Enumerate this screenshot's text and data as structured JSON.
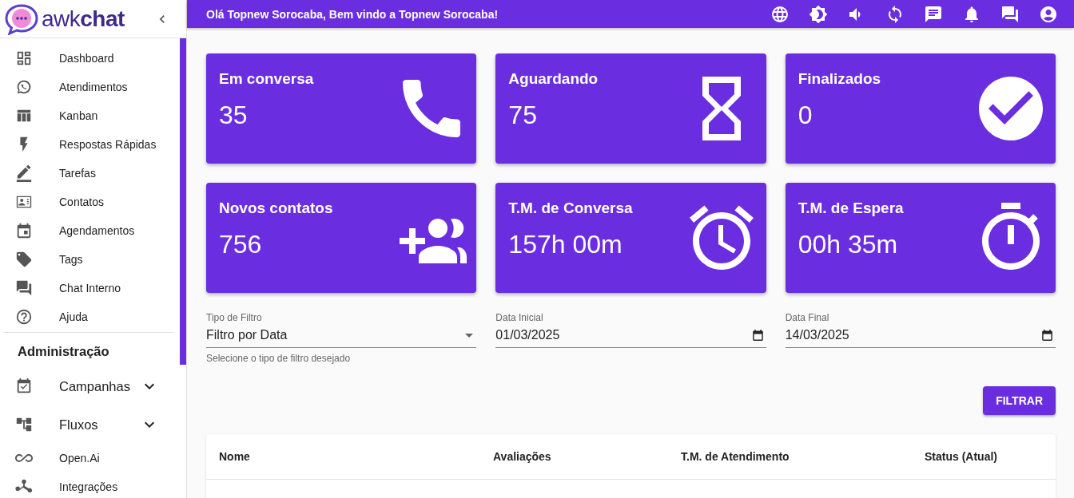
{
  "logo": {
    "text": "awk**chat**"
  },
  "topbar": {
    "greeting": "Olá Topnew Sorocaba, Bem vindo a Topnew Sorocaba!"
  },
  "sidebar": {
    "items": [
      {
        "label": "Dashboard",
        "kind": "link"
      },
      {
        "label": "Atendimentos",
        "kind": "link"
      },
      {
        "label": "Kanban",
        "kind": "link"
      },
      {
        "label": "Respostas Rápidas",
        "kind": "link"
      },
      {
        "label": "Tarefas",
        "kind": "link"
      },
      {
        "label": "Contatos",
        "kind": "link"
      },
      {
        "label": "Agendamentos",
        "kind": "link"
      },
      {
        "label": "Tags",
        "kind": "link"
      },
      {
        "label": "Chat Interno",
        "kind": "link"
      },
      {
        "label": "Ajuda",
        "kind": "link"
      }
    ],
    "section_title": "Administração",
    "admin_items": [
      {
        "label": "Campanhas",
        "kind": "group"
      },
      {
        "label": "Fluxos",
        "kind": "group"
      },
      {
        "label": "Open.Ai",
        "kind": "link"
      },
      {
        "label": "Integrações",
        "kind": "link"
      }
    ]
  },
  "cards": [
    {
      "title": "Em conversa",
      "value": "35"
    },
    {
      "title": "Aguardando",
      "value": "75"
    },
    {
      "title": "Finalizados",
      "value": "0"
    },
    {
      "title": "Novos contatos",
      "value": "756"
    },
    {
      "title": "T.M. de Conversa",
      "value": "157h 00m"
    },
    {
      "title": "T.M. de Espera",
      "value": "00h 35m"
    }
  ],
  "filters": {
    "type": {
      "label": "Tipo de Filtro",
      "value": "Filtro por Data",
      "helper": "Selecione o tipo de filtro desejado"
    },
    "start": {
      "label": "Data Inicial",
      "value": "01/03/2025"
    },
    "end": {
      "label": "Data Final",
      "value": "14/03/2025"
    },
    "button": "FILTRAR"
  },
  "table": {
    "columns": [
      "Nome",
      "Avaliações",
      "T.M. de Atendimento",
      "Status (Atual)"
    ]
  }
}
